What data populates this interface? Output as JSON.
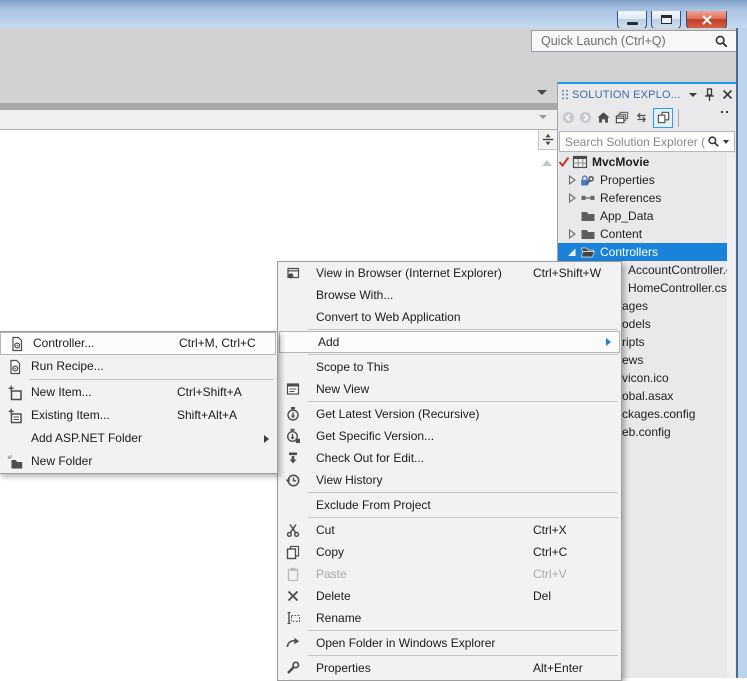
{
  "window": {
    "quick_launch_placeholder": "Quick Launch (Ctrl+Q)",
    "controls": [
      {
        "name": "minimize"
      },
      {
        "name": "maximize"
      },
      {
        "name": "close"
      }
    ]
  },
  "colors": {
    "selection_blue": "#1883d9",
    "panel_accent_line": "#1c97ea",
    "panel_title_blue": "#3e6da8",
    "close_button_red": "#c23b24"
  },
  "solution_explorer": {
    "title": "SOLUTION EXPLO...",
    "search_placeholder": "Search Solution Explorer ( ",
    "toolbar": [
      {
        "icon": "back",
        "disabled": true
      },
      {
        "icon": "forward",
        "disabled": true
      },
      {
        "icon": "home"
      },
      {
        "icon": "collapse-all"
      },
      {
        "icon": "refresh"
      },
      {
        "icon": "sync-active",
        "active": true
      }
    ],
    "tree": [
      {
        "label": "MvcMovie",
        "icon": "project",
        "expander": "none",
        "bold": true,
        "scc": "check",
        "root": true
      },
      {
        "label": "Properties",
        "icon": "properties",
        "expander": "collapsed"
      },
      {
        "label": "References",
        "icon": "references",
        "expander": "collapsed"
      },
      {
        "label": "App_Data",
        "icon": "folder",
        "expander": "none"
      },
      {
        "label": "Content",
        "icon": "folder",
        "expander": "collapsed"
      },
      {
        "label": "Controllers",
        "icon": "folder-open",
        "expander": "expanded",
        "selected": true
      }
    ],
    "tree_fragments": [
      {
        "text": "AccountController.c",
        "indent": 70
      },
      {
        "text": "HomeController.cs",
        "indent": 70
      },
      {
        "text": "ages",
        "indent": 64
      },
      {
        "text": "odels",
        "indent": 64
      },
      {
        "text": "ripts",
        "indent": 64
      },
      {
        "text": "ews",
        "indent": 64
      },
      {
        "text": "vicon.ico",
        "indent": 64
      },
      {
        "text": "obal.asax",
        "indent": 64
      },
      {
        "text": "ckages.config",
        "indent": 64
      },
      {
        "text": "eb.config",
        "indent": 64
      }
    ]
  },
  "context_menu": {
    "items": [
      {
        "type": "item",
        "icon": "browser",
        "label": "View in Browser (Internet Explorer)",
        "shortcut": "Ctrl+Shift+W"
      },
      {
        "type": "item",
        "label": "Browse With..."
      },
      {
        "type": "item",
        "label": "Convert to Web Application"
      },
      {
        "type": "separator"
      },
      {
        "type": "item",
        "label": "Add",
        "submenu": true,
        "highlighted": true
      },
      {
        "type": "separator"
      },
      {
        "type": "item",
        "label": "Scope to This"
      },
      {
        "type": "item",
        "icon": "new-view",
        "label": "New View"
      },
      {
        "type": "separator"
      },
      {
        "type": "item",
        "icon": "get-latest",
        "label": "Get Latest Version (Recursive)"
      },
      {
        "type": "item",
        "icon": "get-specific",
        "label": "Get Specific Version..."
      },
      {
        "type": "item",
        "icon": "check-out",
        "label": "Check Out for Edit..."
      },
      {
        "type": "item",
        "icon": "history",
        "label": "View History"
      },
      {
        "type": "separator"
      },
      {
        "type": "item",
        "label": "Exclude From Project"
      },
      {
        "type": "separator"
      },
      {
        "type": "item",
        "icon": "cut",
        "label": "Cut",
        "shortcut": "Ctrl+X"
      },
      {
        "type": "item",
        "icon": "copy",
        "label": "Copy",
        "shortcut": "Ctrl+C"
      },
      {
        "type": "item",
        "icon": "paste",
        "label": "Paste",
        "shortcut": "Ctrl+V",
        "disabled": true
      },
      {
        "type": "item",
        "icon": "delete",
        "label": "Delete",
        "shortcut": "Del"
      },
      {
        "type": "item",
        "icon": "rename",
        "label": "Rename"
      },
      {
        "type": "separator"
      },
      {
        "type": "item",
        "icon": "explorer",
        "label": "Open Folder in Windows Explorer"
      },
      {
        "type": "separator"
      },
      {
        "type": "item",
        "icon": "wrench",
        "label": "Properties",
        "shortcut": "Alt+Enter"
      }
    ]
  },
  "add_submenu": {
    "items": [
      {
        "type": "item",
        "icon": "controller",
        "label": "Controller...",
        "shortcut": "Ctrl+M, Ctrl+C",
        "highlighted": true
      },
      {
        "type": "item",
        "icon": "recipe",
        "label": "Run Recipe..."
      },
      {
        "type": "separator"
      },
      {
        "type": "item",
        "icon": "new-item",
        "label": "New Item...",
        "shortcut": "Ctrl+Shift+A"
      },
      {
        "type": "item",
        "icon": "existing-item",
        "label": "Existing Item...",
        "shortcut": "Shift+Alt+A"
      },
      {
        "type": "item",
        "label": "Add ASP.NET Folder",
        "submenu": true
      },
      {
        "type": "item",
        "icon": "new-folder",
        "label": "New Folder"
      }
    ]
  }
}
